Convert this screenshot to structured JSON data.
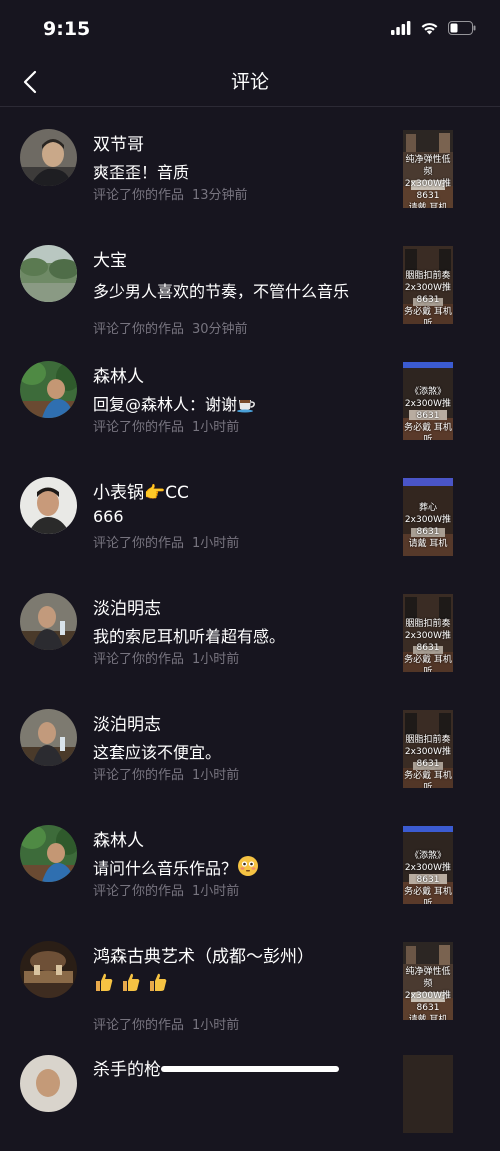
{
  "status_bar": {
    "time": "9:15"
  },
  "header": {
    "title": "评论"
  },
  "comments": [
    {
      "name": "双节哥",
      "text": "爽歪歪！音质",
      "action": "评论了你的作品",
      "time": "13分钟前",
      "thumb": "纯净弹性低频\n2x300W推8631\n请戴    耳机"
    },
    {
      "name": "大宝",
      "text": "多少男人喜欢的节奏，不管什么音乐",
      "action": "评论了你的作品",
      "time": "30分钟前",
      "thumb": "胭脂扣前奏\n2x300W推8631\n务必戴    耳机听"
    },
    {
      "name": "森林人",
      "text": "回复@森林人：谢谢",
      "action": "评论了你的作品",
      "time": "1小时前",
      "thumb": "《添煞》\n2x300W推8631\n务必戴    耳机听"
    },
    {
      "name": "小表锅👉CC",
      "text": "666",
      "action": "评论了你的作品",
      "time": "1小时前",
      "thumb": "葬心\n2x300W推8631\n请戴    耳机"
    },
    {
      "name": "淡泊明志",
      "text": "我的索尼耳机听着超有感。",
      "action": "评论了你的作品",
      "time": "1小时前",
      "thumb": "胭脂扣前奏\n2x300W推8631\n务必戴    耳机听"
    },
    {
      "name": "淡泊明志",
      "text": "这套应该不便宜。",
      "action": "评论了你的作品",
      "time": "1小时前",
      "thumb": "胭脂扣前奏\n2x300W推8631\n务必戴    耳机听"
    },
    {
      "name": "森林人",
      "text": "请问什么音乐作品？",
      "action": "评论了你的作品",
      "time": "1小时前",
      "thumb": "《添煞》\n2x300W推8631\n务必戴    耳机听"
    },
    {
      "name": "鸿森古典艺术（成都～彭州）",
      "text": "",
      "action": "评论了你的作品",
      "time": "1小时前",
      "thumb": "纯净弹性低频\n2x300W推8631\n请戴    耳机"
    },
    {
      "name": "杀手的枪",
      "text": "",
      "action": "",
      "time": "",
      "thumb": ""
    }
  ]
}
